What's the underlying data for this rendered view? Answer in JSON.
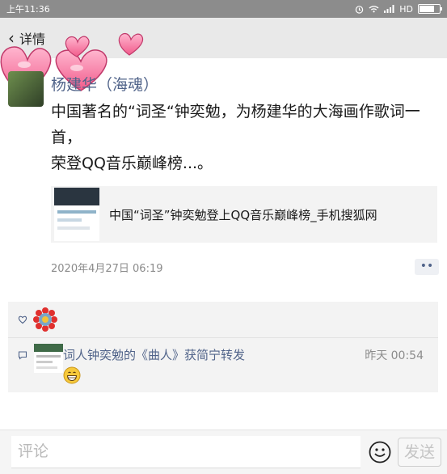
{
  "status_bar": {
    "time": "上午11:36",
    "network": "HD"
  },
  "nav": {
    "back_glyph": "‹",
    "title": "详情"
  },
  "post": {
    "author": "杨建华（海魂）",
    "text": "中国著名的“词圣“钟奕勉，为杨建华的大海画作歌词一首，\n荣登QQ音乐巅峰榜...。",
    "link_title": "中国“词圣”钟奕勉登上QQ音乐巅峰榜_手机搜狐网",
    "timestamp": "2020年4月27日 06:19",
    "more_label": "••"
  },
  "comments": [
    {
      "author": "词人钟奕勉的《曲人》获简宁转发",
      "time": "昨天 00:54",
      "emoji": "grinning-face"
    }
  ],
  "input": {
    "placeholder": "评论",
    "send_label": "发送"
  },
  "colors": {
    "link_blue": "#51648a",
    "heart_pink": "#f15b8b",
    "panel_gray": "#f3f3f3"
  }
}
